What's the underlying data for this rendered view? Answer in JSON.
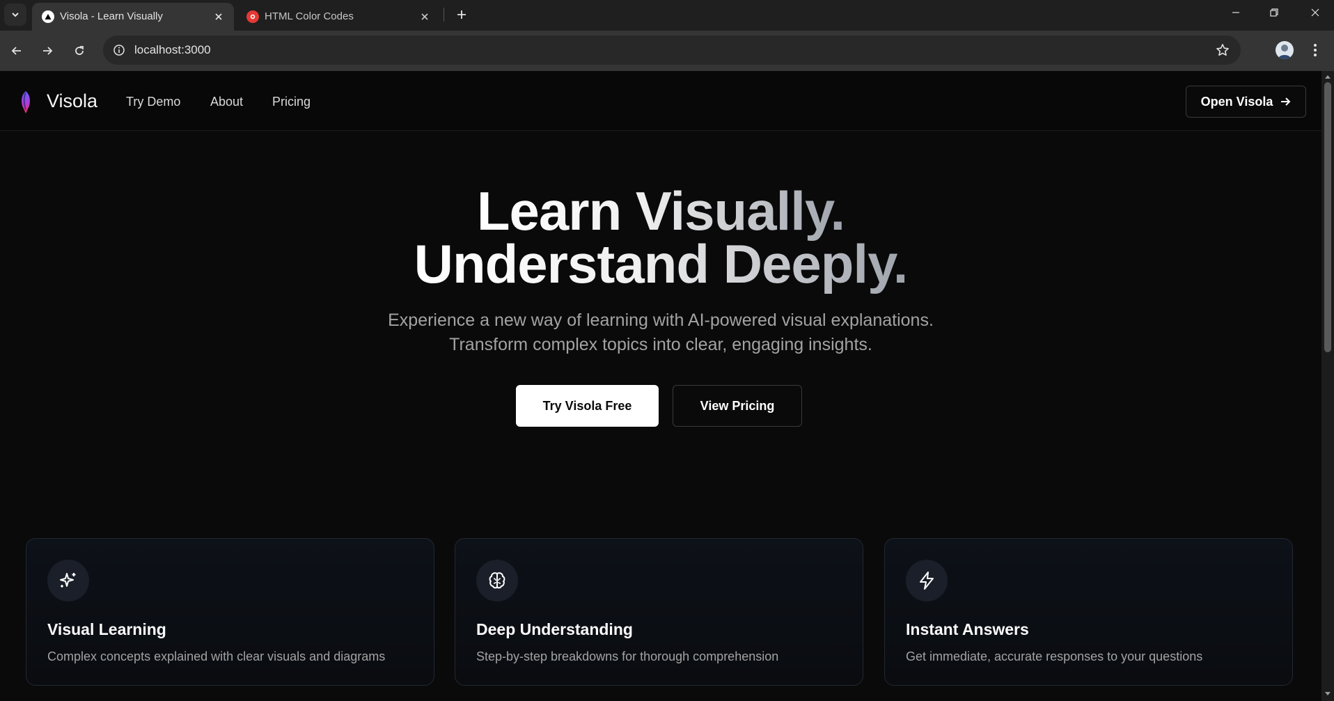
{
  "browser": {
    "tabs": [
      {
        "title": "Visola - Learn Visually",
        "active": true
      },
      {
        "title": "HTML Color Codes",
        "active": false
      }
    ],
    "address": "localhost:3000"
  },
  "site": {
    "brand": "Visola",
    "nav": [
      "Try Demo",
      "About",
      "Pricing"
    ],
    "open_button": "Open Visola"
  },
  "hero": {
    "title_line1": "Learn Visually.",
    "title_line2": "Understand Deeply.",
    "subtitle_line1": "Experience a new way of learning with AI-powered visual explanations.",
    "subtitle_line2": "Transform complex topics into clear, engaging insights.",
    "primary_cta": "Try Visola Free",
    "secondary_cta": "View Pricing"
  },
  "features": [
    {
      "icon": "sparkles-icon",
      "title": "Visual Learning",
      "description": "Complex concepts explained with clear visuals and diagrams"
    },
    {
      "icon": "brain-icon",
      "title": "Deep Understanding",
      "description": "Step-by-step breakdowns for thorough comprehension"
    },
    {
      "icon": "lightning-icon",
      "title": "Instant Answers",
      "description": "Get immediate, accurate responses to your questions"
    }
  ],
  "colors": {
    "background": "#0a0a0a",
    "card_border": "#222833",
    "muted_text": "#a3a3a3",
    "primary_button": "#ffffff"
  }
}
